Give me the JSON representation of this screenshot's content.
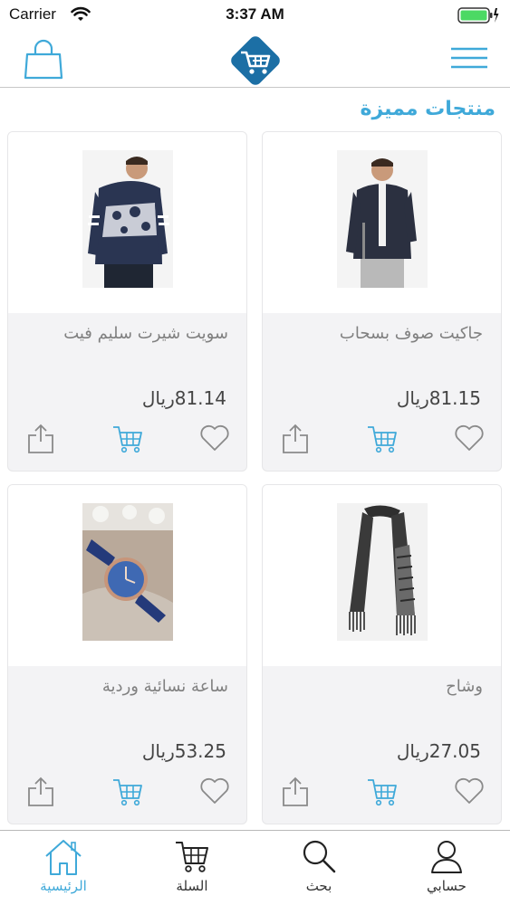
{
  "status_bar": {
    "carrier": "Carrier",
    "time": "3:37 AM"
  },
  "colors": {
    "accent": "#3fa9d9",
    "logo_blue": "#1c6fa5",
    "icon_gray": "#8a8a8a",
    "battery_green": "#4cd964"
  },
  "section": {
    "title": "منتجات مميزة"
  },
  "products": [
    {
      "name": "جاكيت صوف بسحاب",
      "price": "81.15ريال",
      "image": "man-in-navy-zip-jacket"
    },
    {
      "name": "سويت شيرت سليم فيت",
      "price": "81.14ريال",
      "image": "man-in-patterned-sweatshirt"
    },
    {
      "name": "وشاح",
      "price": "27.05ريال",
      "image": "dark-checked-scarf"
    },
    {
      "name": "ساعة نسائية وردية",
      "price": "53.25ريال",
      "image": "blue-strap-watch"
    }
  ],
  "tab_bar": {
    "tabs": [
      {
        "label": "الرئيسية",
        "icon": "home-icon",
        "active": true
      },
      {
        "label": "السلة",
        "icon": "cart-icon",
        "active": false
      },
      {
        "label": "بحث",
        "icon": "search-icon",
        "active": false
      },
      {
        "label": "حسابي",
        "icon": "user-icon",
        "active": false
      }
    ]
  }
}
